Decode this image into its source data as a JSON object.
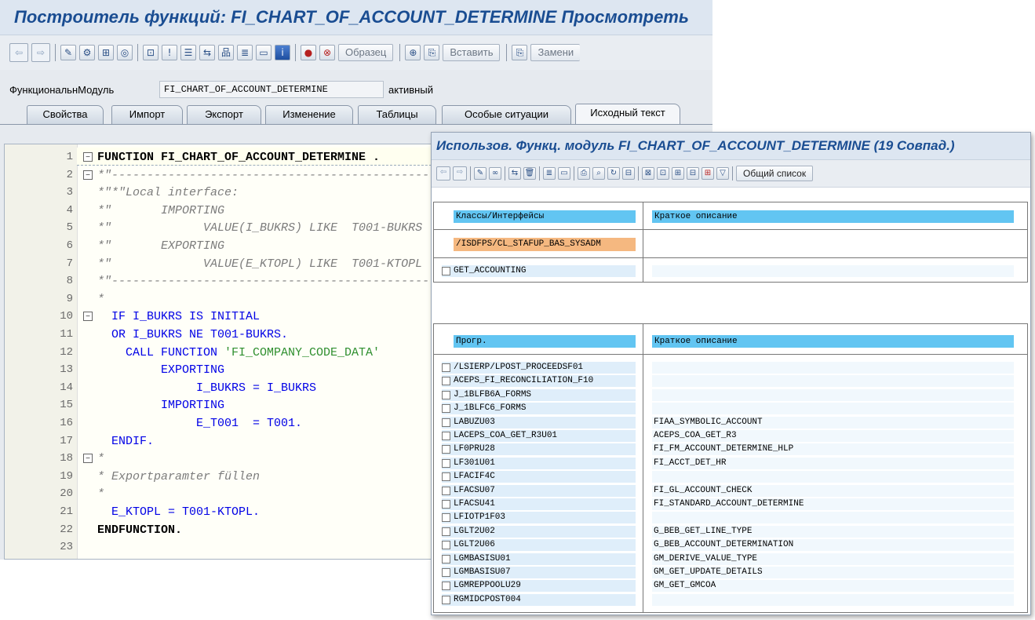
{
  "function_builder": {
    "title": "Построитель функций: FI_CHART_OF_ACCOUNT_DETERMINE Просмотреть",
    "toolbar": {
      "pattern_label": "Образец",
      "insert_label": "Вставить",
      "replace_label": "Замени"
    },
    "function_module": {
      "label": "ФункциональнМодуль",
      "value": "FI_CHART_OF_ACCOUNT_DETERMINE",
      "status": "активный"
    },
    "tabs": [
      {
        "label": "Свойства"
      },
      {
        "label": "Импорт"
      },
      {
        "label": "Экспорт"
      },
      {
        "label": "Изменение"
      },
      {
        "label": "Таблицы"
      },
      {
        "label": "Особые ситуации"
      },
      {
        "label": "Исходный текст",
        "active": true
      }
    ],
    "source_lines": [
      {
        "n": "1",
        "text": "FUNCTION FI_CHART_OF_ACCOUNT_DETERMINE ."
      },
      {
        "n": "2",
        "text": "*\"----------------------------------------------------------"
      },
      {
        "n": "3",
        "text": "*\"*\"Local interface:"
      },
      {
        "n": "4",
        "text": "*\"       IMPORTING"
      },
      {
        "n": "5",
        "text": "*\"             VALUE(I_BUKRS) LIKE  T001-BUKRS"
      },
      {
        "n": "6",
        "text": "*\"       EXPORTING"
      },
      {
        "n": "7",
        "text": "*\"             VALUE(E_KTOPL) LIKE  T001-KTOPL"
      },
      {
        "n": "8",
        "text": "*\"----------------------------------------------------------"
      },
      {
        "n": "9",
        "text": "*"
      },
      {
        "n": "10",
        "text": "  IF I_BUKRS IS INITIAL"
      },
      {
        "n": "11",
        "text": "  OR I_BUKRS NE T001-BUKRS."
      },
      {
        "n": "12",
        "text": "    CALL FUNCTION 'FI_COMPANY_CODE_DATA'"
      },
      {
        "n": "13",
        "text": "         EXPORTING"
      },
      {
        "n": "14",
        "text": "              I_BUKRS = I_BUKRS"
      },
      {
        "n": "15",
        "text": "         IMPORTING"
      },
      {
        "n": "16",
        "text": "              E_T001  = T001."
      },
      {
        "n": "17",
        "text": "  ENDIF."
      },
      {
        "n": "18",
        "text": "*"
      },
      {
        "n": "19",
        "text": "* Exportparamter füllen"
      },
      {
        "n": "20",
        "text": "*"
      },
      {
        "n": "21",
        "text": "  E_KTOPL = T001-KTOPL."
      },
      {
        "n": "22",
        "text": "ENDFUNCTION."
      },
      {
        "n": "23",
        "text": ""
      }
    ]
  },
  "where_used": {
    "title": "Использов. Функц. модуль FI_CHART_OF_ACCOUNT_DETERMINE (19 Совпад.)",
    "toolbar": {
      "general_list_label": "Общий список"
    },
    "classes_section": {
      "col1_header": "Классы/Интерфейсы",
      "col2_header": "Краткое описание",
      "class_name": "/ISDFPS/CL_STAFUP_BAS_SYSADM",
      "methods": [
        {
          "name": "GET_ACCOUNTING",
          "desc": ""
        }
      ]
    },
    "programs_section": {
      "col1_header": "Прогр.",
      "col2_header": "Краткое описание",
      "rows": [
        {
          "name": "/LSIERP/LPOST_PROCEEDSF01",
          "desc": ""
        },
        {
          "name": "ACEPS_FI_RECONCILIATION_F10",
          "desc": ""
        },
        {
          "name": "J_1BLFB6A_FORMS",
          "desc": ""
        },
        {
          "name": "J_1BLFC6_FORMS",
          "desc": ""
        },
        {
          "name": "LABUZU03",
          "desc": "FIAA_SYMBOLIC_ACCOUNT"
        },
        {
          "name": "LACEPS_COA_GET_R3U01",
          "desc": "ACEPS_COA_GET_R3"
        },
        {
          "name": "LF0PRU28",
          "desc": "FI_FM_ACCOUNT_DETERMINE_HLP"
        },
        {
          "name": "LF301U01",
          "desc": "FI_ACCT_DET_HR"
        },
        {
          "name": "LFACIF4C",
          "desc": ""
        },
        {
          "name": "LFACSU07",
          "desc": "FI_GL_ACCOUNT_CHECK"
        },
        {
          "name": "LFACSU41",
          "desc": "FI_STANDARD_ACCOUNT_DETERMINE"
        },
        {
          "name": "LFIOTP1F03",
          "desc": ""
        },
        {
          "name": "LGLT2U02",
          "desc": "G_BEB_GET_LINE_TYPE"
        },
        {
          "name": "LGLT2U06",
          "desc": "G_BEB_ACCOUNT_DETERMINATION"
        },
        {
          "name": "LGMBASISU01",
          "desc": "GM_DERIVE_VALUE_TYPE"
        },
        {
          "name": "LGMBASISU07",
          "desc": "GM_GET_UPDATE_DETAILS"
        },
        {
          "name": "LGMREPPOOLU29",
          "desc": "GM_GET_GMCOA"
        },
        {
          "name": "RGMIDCPOST004",
          "desc": ""
        }
      ]
    }
  }
}
